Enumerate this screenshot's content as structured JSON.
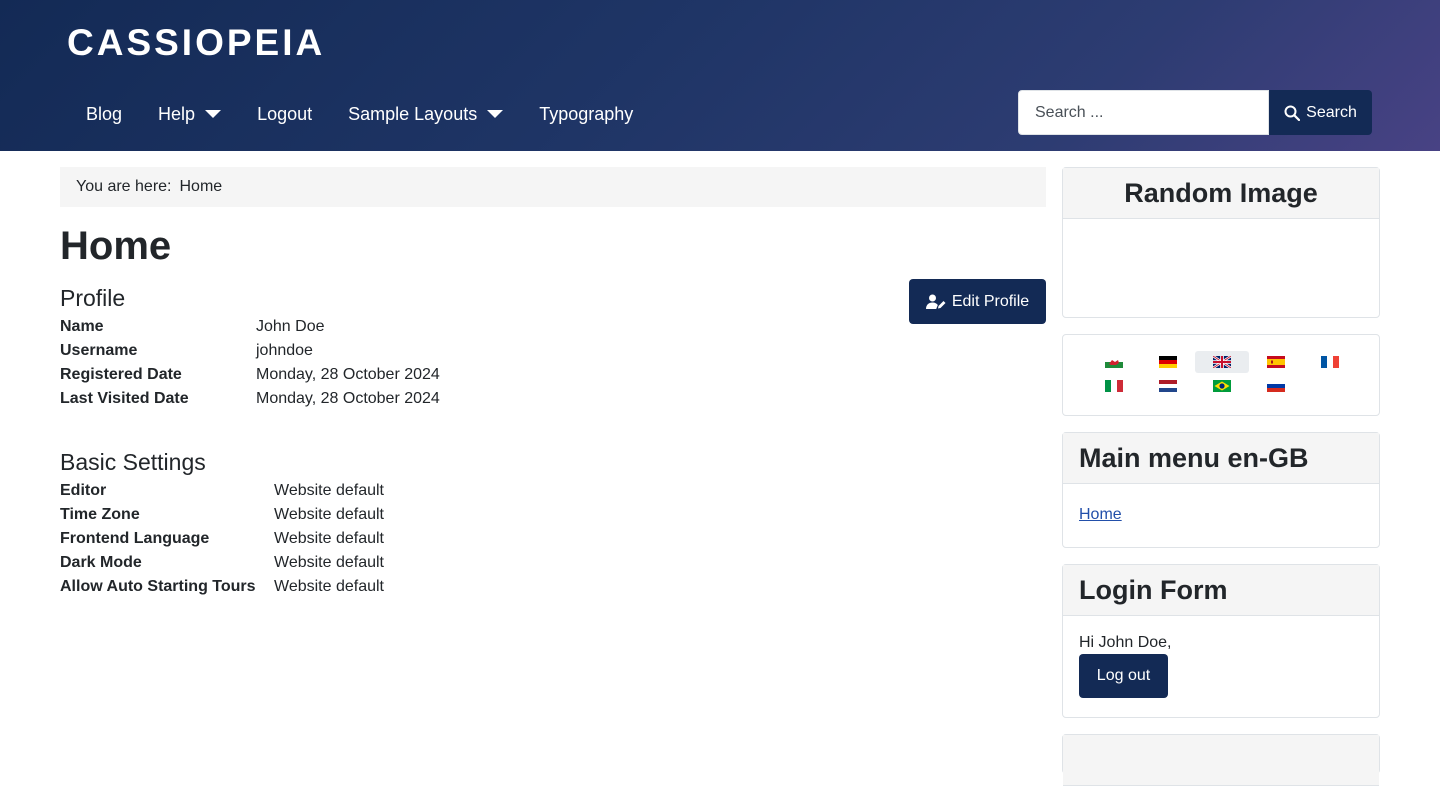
{
  "header": {
    "brand": "CASSIOPEIA",
    "nav": [
      {
        "label": "Blog"
      },
      {
        "label": "Help"
      },
      {
        "label": "Logout"
      },
      {
        "label": "Sample Layouts"
      },
      {
        "label": "Typography"
      }
    ],
    "search": {
      "placeholder": "Search ...",
      "button_label": "Search"
    }
  },
  "breadcrumb": {
    "prefix": "You are here:",
    "current": "Home"
  },
  "page": {
    "title": "Home",
    "profile": {
      "heading": "Profile",
      "edit_label": "Edit Profile",
      "fields": [
        {
          "label": "Name",
          "value": "John Doe"
        },
        {
          "label": "Username",
          "value": "johndoe"
        },
        {
          "label": "Registered Date",
          "value": "Monday, 28 October 2024"
        },
        {
          "label": "Last Visited Date",
          "value": "Monday, 28 October 2024"
        }
      ]
    },
    "settings": {
      "heading": "Basic Settings",
      "fields": [
        {
          "label": "Editor",
          "value": "Website default"
        },
        {
          "label": "Time Zone",
          "value": "Website default"
        },
        {
          "label": "Frontend Language",
          "value": "Website default"
        },
        {
          "label": "Dark Mode",
          "value": "Website default"
        },
        {
          "label": "Allow Auto Starting Tours",
          "value": "Website default"
        }
      ]
    }
  },
  "sidebar": {
    "random_image": {
      "title": "Random Image"
    },
    "languages": {
      "flags": [
        {
          "icon": "wales-flag-icon"
        },
        {
          "icon": "germany-flag-icon"
        },
        {
          "icon": "uk-flag-icon",
          "active": true
        },
        {
          "icon": "spain-flag-icon"
        },
        {
          "icon": "france-flag-icon"
        },
        {
          "icon": "italy-flag-icon"
        },
        {
          "icon": "netherlands-flag-icon"
        },
        {
          "icon": "brazil-flag-icon"
        },
        {
          "icon": "russia-flag-icon"
        }
      ]
    },
    "main_menu": {
      "title": "Main menu en-GB",
      "items": [
        {
          "label": "Home"
        }
      ]
    },
    "login": {
      "title": "Login Form",
      "greeting": "Hi John Doe,",
      "button_label": "Log out"
    }
  },
  "colors": {
    "primary": "#132a55",
    "link": "#224faa",
    "header_end": "#484284"
  }
}
